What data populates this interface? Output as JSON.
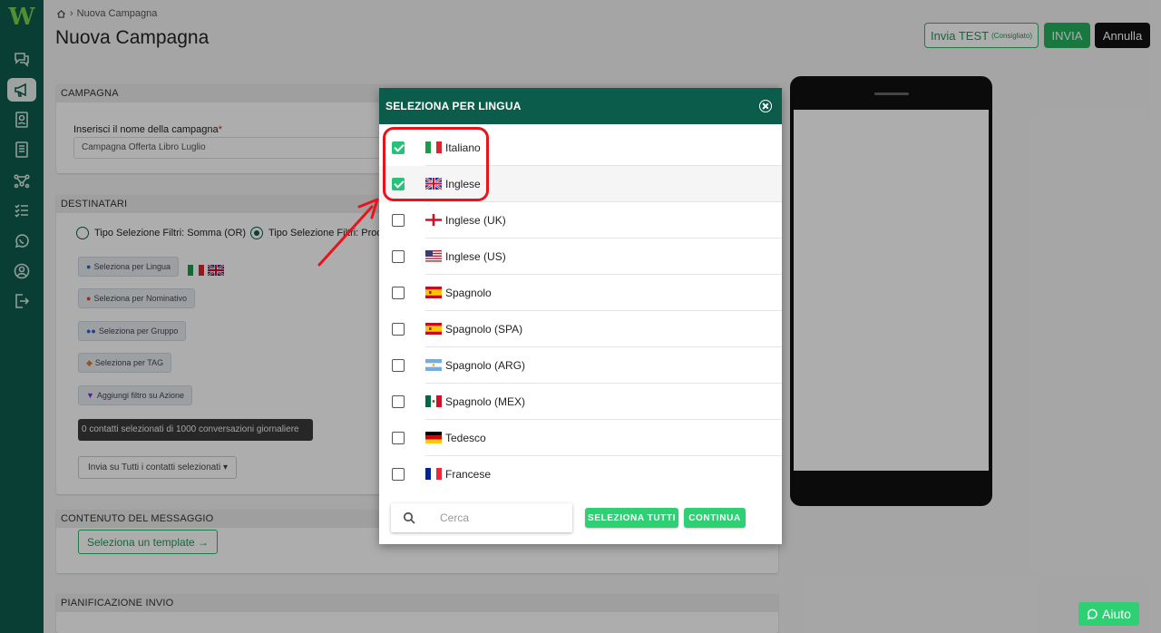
{
  "logo": "W",
  "breadcrumb": {
    "current": "Nuova Campagna"
  },
  "page_title": "Nuova Campagna",
  "header_buttons": {
    "test_label": "Invia TEST",
    "test_note": "(Consigliato)",
    "send_label": "INVIA",
    "cancel_label": "Annulla"
  },
  "sidebar_icons": [
    "chat-icon",
    "megaphone-icon",
    "contacts-icon",
    "document-icon",
    "flow-icon",
    "checklist-icon",
    "whatsapp-icon",
    "user-icon",
    "logout-icon"
  ],
  "campaign": {
    "header": "CAMPAGNA",
    "name_label": "Inserisci il nome della campagna",
    "required_mark": "*",
    "name_value": "Campagna Offerta Libro Luglio"
  },
  "recipients": {
    "header": "DESTINATARI",
    "radio_or": "Tipo Selezione Filtri: Somma (OR)",
    "radio_and": "Tipo Selezione Filtri: Prodo",
    "btn_language": "Seleziona per Lingua",
    "btn_name": "Seleziona per Nominativo",
    "btn_group": "Seleziona per Gruppo",
    "btn_tag": "Seleziona per TAG",
    "btn_action": "Aggiungi filtro su Azione",
    "counter": "0 contatti selezionati di 1000 conversazioni giornaliere",
    "send_select": "Invia su Tutti i contatti selezionati"
  },
  "message": {
    "header": "CONTENUTO DEL MESSAGGIO",
    "template_button": "Seleziona un template"
  },
  "schedule": {
    "header": "PIANIFICAZIONE INVIO"
  },
  "modal": {
    "title": "SELEZIONA PER LINGUA",
    "languages": [
      {
        "name": "Italiano",
        "checked": true
      },
      {
        "name": "Inglese",
        "checked": true
      },
      {
        "name": "Inglese (UK)",
        "checked": false
      },
      {
        "name": "Inglese (US)",
        "checked": false
      },
      {
        "name": "Spagnolo",
        "checked": false
      },
      {
        "name": "Spagnolo (SPA)",
        "checked": false
      },
      {
        "name": "Spagnolo (ARG)",
        "checked": false
      },
      {
        "name": "Spagnolo (MEX)",
        "checked": false
      },
      {
        "name": "Tedesco",
        "checked": false
      },
      {
        "name": "Francese",
        "checked": false
      }
    ],
    "search_placeholder": "Cerca",
    "select_all": "SELEZIONA TUTTI",
    "continue": "CONTINUA"
  },
  "help_button": "Aiuto",
  "colors": {
    "brand": "#0c5c4c",
    "accent": "#24b25f",
    "annotation": "#e8141c"
  }
}
